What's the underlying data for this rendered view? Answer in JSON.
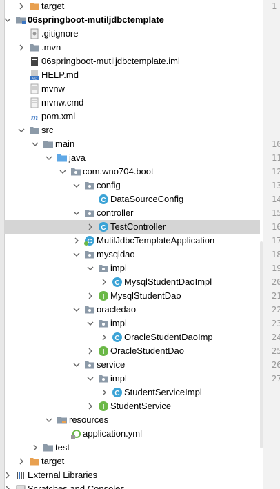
{
  "tree": [
    {
      "label": "target",
      "icon": "folder-orange",
      "arrow": "right",
      "depth": 1
    },
    {
      "label": "06springboot-mutiljdbctemplate",
      "icon": "module",
      "arrow": "down",
      "depth": 0,
      "bold": true
    },
    {
      "label": ".gitignore",
      "icon": "gitignore",
      "arrow": "none",
      "depth": 1
    },
    {
      "label": ".mvn",
      "icon": "folder",
      "arrow": "right",
      "depth": 1
    },
    {
      "label": "06springboot-mutiljdbctemplate.iml",
      "icon": "iml",
      "arrow": "none",
      "depth": 1
    },
    {
      "label": "HELP.md",
      "icon": "md",
      "arrow": "none",
      "depth": 1
    },
    {
      "label": "mvnw",
      "icon": "file",
      "arrow": "none",
      "depth": 1
    },
    {
      "label": "mvnw.cmd",
      "icon": "file",
      "arrow": "none",
      "depth": 1
    },
    {
      "label": "pom.xml",
      "icon": "maven",
      "arrow": "none",
      "depth": 1
    },
    {
      "label": "src",
      "icon": "folder",
      "arrow": "down",
      "depth": 1
    },
    {
      "label": "main",
      "icon": "folder",
      "arrow": "down",
      "depth": 2
    },
    {
      "label": "java",
      "icon": "folder-blue",
      "arrow": "down",
      "depth": 3
    },
    {
      "label": "com.wno704.boot",
      "icon": "package",
      "arrow": "down",
      "depth": 4
    },
    {
      "label": "config",
      "icon": "package",
      "arrow": "down",
      "depth": 5
    },
    {
      "label": "DataSourceConfig",
      "icon": "class",
      "arrow": "none",
      "depth": 6
    },
    {
      "label": "controller",
      "icon": "package",
      "arrow": "down",
      "depth": 5
    },
    {
      "label": "TestController",
      "icon": "class",
      "arrow": "right",
      "depth": 6,
      "selected": true
    },
    {
      "label": "MutilJdbcTemplateApplication",
      "icon": "spring-class",
      "arrow": "right",
      "depth": 5
    },
    {
      "label": "mysqldao",
      "icon": "package",
      "arrow": "down",
      "depth": 5
    },
    {
      "label": "impl",
      "icon": "package",
      "arrow": "down",
      "depth": 6
    },
    {
      "label": "MysqlStudentDaoImpl",
      "icon": "class",
      "arrow": "right",
      "depth": 7
    },
    {
      "label": "MysqlStudentDao",
      "icon": "interface",
      "arrow": "right",
      "depth": 6
    },
    {
      "label": "oracledao",
      "icon": "package",
      "arrow": "down",
      "depth": 5
    },
    {
      "label": "impl",
      "icon": "package",
      "arrow": "down",
      "depth": 6
    },
    {
      "label": "OracleStudentDaoImp",
      "icon": "class",
      "arrow": "right",
      "depth": 7
    },
    {
      "label": "OracleStudentDao",
      "icon": "interface",
      "arrow": "right",
      "depth": 6
    },
    {
      "label": "service",
      "icon": "package",
      "arrow": "down",
      "depth": 5
    },
    {
      "label": "impl",
      "icon": "package",
      "arrow": "down",
      "depth": 6
    },
    {
      "label": "StudentServiceImpl",
      "icon": "class",
      "arrow": "right",
      "depth": 7
    },
    {
      "label": "StudentService",
      "icon": "interface",
      "arrow": "right",
      "depth": 6
    },
    {
      "label": "resources",
      "icon": "folder-resources",
      "arrow": "down",
      "depth": 3
    },
    {
      "label": "application.yml",
      "icon": "yml",
      "arrow": "none",
      "depth": 4
    },
    {
      "label": "test",
      "icon": "folder",
      "arrow": "right",
      "depth": 2
    },
    {
      "label": "target",
      "icon": "folder-orange",
      "arrow": "right",
      "depth": 1
    },
    {
      "label": "External Libraries",
      "icon": "libraries",
      "arrow": "right",
      "depth": 0
    },
    {
      "label": "Scratches and Consoles",
      "icon": "scratches",
      "arrow": "right",
      "depth": 0
    }
  ],
  "gutter_lines": [
    "1",
    "",
    "",
    "",
    "",
    "",
    "",
    "",
    "",
    "",
    "10",
    "11",
    "12",
    "13",
    "14",
    "15",
    "16",
    "17",
    "18",
    "19",
    "20",
    "21",
    "22",
    "23",
    "24",
    "25",
    "26",
    "27"
  ],
  "colors": {
    "folder": "#8c9aa8",
    "folder_orange": "#e8a050",
    "folder_blue": "#5fa8e6",
    "package": "#8c9aa8",
    "class": "#3ba3d6",
    "interface": "#6bb847",
    "selected_row": "#d5d5d5"
  }
}
